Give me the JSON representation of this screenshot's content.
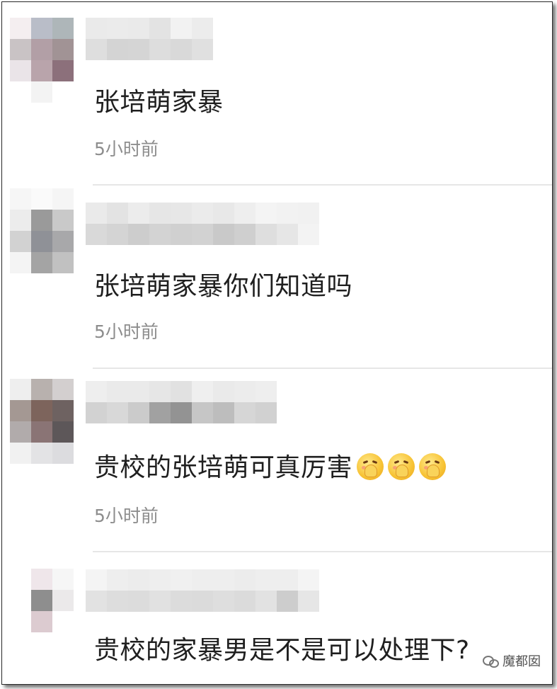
{
  "comments": [
    {
      "text": "张培萌家暴",
      "time": "5小时前",
      "avatar_pixels": [
        "#f4eef0",
        "#b9bdc8",
        "#aeb6b9",
        "#c9c3c5",
        "#b29fa6",
        "#a19395",
        "#eae4e8",
        "#b9a4ab",
        "#8c707b",
        "#ffffff",
        "#f3f3f3",
        "#ffffff"
      ],
      "username_pixels": [
        [
          "#eaeaea",
          "#ebebeb",
          "#eaeaea",
          "#e3e3e3",
          "#f2f2f2",
          "#ececec"
        ],
        [
          "#dedede",
          "#d4d4d4",
          "#d5d5d5",
          "#dddddd",
          "#d9d9d9",
          "#e0e0e0"
        ]
      ]
    },
    {
      "text": "张培萌家暴你们知道吗",
      "time": "5小时前",
      "avatar_pixels": [
        "#f6f6f6",
        "#fafafa",
        "#f5f5f5",
        "#ececec",
        "#9a9a9a",
        "#c9c9c9",
        "#d2d2d2",
        "#8f9197",
        "#a8a8aa",
        "#f4f4f4",
        "#a4a4a4",
        "#c1c1c1"
      ],
      "username_pixels": [
        [
          "#eaeaea",
          "#e3e3e3",
          "#ececec",
          "#e6e6e6",
          "#e7e7e7",
          "#ebebeb",
          "#e8e8e8",
          "#eeeeee",
          "#f4f4f4",
          "#f2f2f2",
          "#f1f1f1"
        ],
        [
          "#d9d9d9",
          "#d4d4d4",
          "#cdcdcd",
          "#d3d3d3",
          "#d0d0d0",
          "#d2d2d2",
          "#c9c9c9",
          "#cfcfcf",
          "#dedede",
          "#e6e6e6",
          "#f3f3f3"
        ]
      ]
    },
    {
      "text": "贵校的张培萌可真厉害",
      "time": "5小时前",
      "emoji_count": 3,
      "avatar_pixels": [
        "#eeeeee",
        "#b8b1ae",
        "#d3cfcf",
        "#a49893",
        "#7d645c",
        "#6e6261",
        "#b1abab",
        "#8a7475",
        "#5d5759",
        "#f1f1f1",
        "#e3e3e5",
        "#dcdcdf"
      ],
      "username_pixels": [
        [
          "#eeeeee",
          "#eaeaea",
          "#eaeaea",
          "#e6e6e6",
          "#e1e1e1",
          "#efefef",
          "#eaeaea",
          "#ececec",
          "#eeeeee"
        ],
        [
          "#d2d2d2",
          "#d8d8d8",
          "#cbcbcb",
          "#a1a1a1",
          "#939393",
          "#c6c6c6",
          "#bdbdbd",
          "#d6d6d6",
          "#d1d1d1"
        ]
      ]
    },
    {
      "text": "贵校的家暴男是不是可以处理下?",
      "time": "",
      "avatar_pixels": [
        "#ffffff",
        "#efe6ea",
        "#f6f6f6",
        "#ffffff",
        "#8e8e8e",
        "#ebe9ea",
        "#ffffff",
        "#dccbd0",
        "#ffffff",
        "#ffffff",
        "#ffffff",
        "#ffffff"
      ],
      "username_pixels": [
        [
          "#f4f4f4",
          "#eeeeee",
          "#ececec",
          "#eeeeee",
          "#f0f0f0",
          "#eeeeee",
          "#eeeeee",
          "#ececec",
          "#eeeeee",
          "#eeeeee",
          "#f4f4f4"
        ],
        [
          "#e2e2e2",
          "#dddddd",
          "#dcdcdc",
          "#e1e1e1",
          "#dcdcdc",
          "#dbdbdb",
          "#dedede",
          "#dbdbdb",
          "#e2e2e2",
          "#cdcdcd",
          "#e6e6e6"
        ]
      ]
    }
  ],
  "watermark": {
    "label": "魔都囡"
  }
}
